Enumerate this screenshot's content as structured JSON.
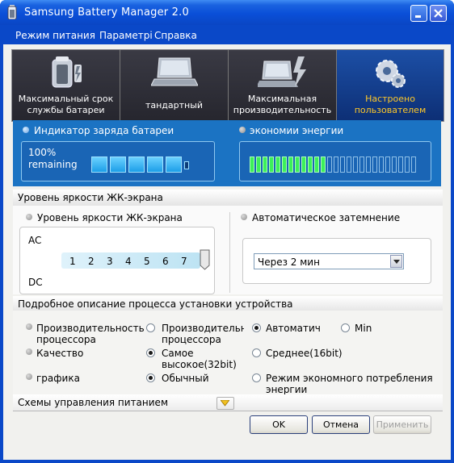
{
  "window": {
    "title": "Samsung Battery Manager 2.0"
  },
  "menu": [
    "Режим питания",
    "Параметрі",
    "Справка"
  ],
  "modes": [
    {
      "label": "Максимальный срок службы батареи",
      "icon": "battery-icon",
      "selected": false
    },
    {
      "label": "тандартный",
      "icon": "laptop-icon",
      "selected": false
    },
    {
      "label": "Максимальная производительность",
      "icon": "laptop-lightning-icon",
      "selected": false
    },
    {
      "label": "Настроено пользователем",
      "icon": "gears-icon",
      "selected": true
    }
  ],
  "battery": {
    "indicator_label": "Индикатор заряда батареи",
    "percent_text": "100%",
    "remaining_text": "remaining",
    "level": 1.0,
    "cells_filled": 5,
    "cells_total": 5
  },
  "energy": {
    "label": "экономии энергии",
    "segments_filled": 12,
    "segments_total": 26
  },
  "brightness": {
    "section_title": "Уровень яркости ЖК-экрана",
    "label": "Уровень яркости ЖК-экрана",
    "ac_label": "AC",
    "dc_label": "DC",
    "levels": [
      "1",
      "2",
      "3",
      "4",
      "5",
      "6",
      "7"
    ],
    "auto_label": "Автоматическое затемнение",
    "auto_value": "Через 2 мин"
  },
  "settings": {
    "section_title": "Подробное описание процесса установки устройства",
    "rows": [
      {
        "label": "Производительность процессора",
        "options": [
          {
            "text": "Производительно процессора",
            "selected": false
          },
          {
            "text": "Автоматич",
            "selected": true
          },
          {
            "text": "Min",
            "selected": false
          }
        ]
      },
      {
        "label": "Качество",
        "options": [
          {
            "text": "Самое высокое(32bit)",
            "selected": true
          },
          {
            "text": "Среднее(16bit)",
            "selected": false
          }
        ]
      },
      {
        "label": "графика",
        "options": [
          {
            "text": "Обычный",
            "selected": true
          },
          {
            "text": "Режим экономного потребления энергии",
            "selected": false
          }
        ]
      }
    ]
  },
  "power_schemes": {
    "label": "Схемы управления питанием"
  },
  "buttons": {
    "ok": "OK",
    "cancel": "Отмена",
    "apply": "Применить"
  },
  "colors": {
    "title_blue": "#0a48c8",
    "panel_blue": "#1b73c3",
    "selected_tab": "#0d2f75",
    "accent_yellow": "#ffc828",
    "energy_green": "#3cf05a"
  }
}
